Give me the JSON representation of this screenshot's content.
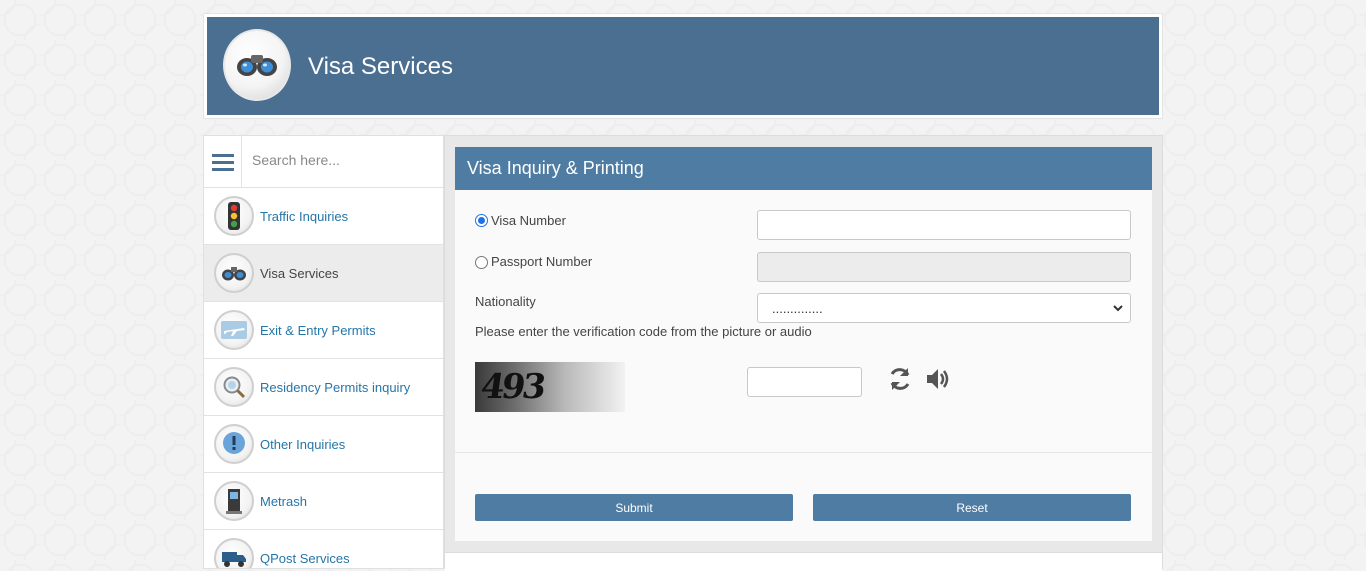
{
  "header": {
    "title": "Visa Services",
    "logo_icon": "binoculars-icon",
    "background": "#4a6f91"
  },
  "sidebar": {
    "menu_icon": "hamburger-menu-icon",
    "search_placeholder": "Search here...",
    "items": [
      {
        "label": "Traffic Inquiries",
        "icon": "traffic-light-icon",
        "active": false
      },
      {
        "label": "Visa Services",
        "icon": "binoculars-icon",
        "active": true
      },
      {
        "label": "Exit & Entry Permits",
        "icon": "airplane-icon",
        "active": false
      },
      {
        "label": "Residency Permits inquiry",
        "icon": "magnifier-globe-icon",
        "active": false
      },
      {
        "label": "Other Inquiries",
        "icon": "exclamation-bubble-icon",
        "active": false
      },
      {
        "label": "Metrash",
        "icon": "kiosk-icon",
        "active": false
      },
      {
        "label": "QPost Services",
        "icon": "delivery-truck-icon",
        "active": false
      }
    ]
  },
  "form": {
    "title": "Visa Inquiry & Printing",
    "visa_number_label": "Visa Number",
    "visa_number_value": "",
    "visa_number_checked": true,
    "passport_number_label": "Passport Number",
    "passport_number_value": "",
    "passport_number_checked": false,
    "nationality_label": "Nationality",
    "nationality_selected": "..............",
    "captcha_instruction": "Please enter the verification code from the picture or audio",
    "captcha_text": "493",
    "captcha_input_value": "",
    "refresh_icon": "refresh-icon",
    "audio_icon": "speaker-icon",
    "submit_label": "Submit",
    "reset_label": "Reset"
  },
  "colors": {
    "header_bg": "#4a6f91",
    "panel_header_bg": "#4f7ca3",
    "link": "#2576a8",
    "button_bg": "#4f7ca3"
  }
}
